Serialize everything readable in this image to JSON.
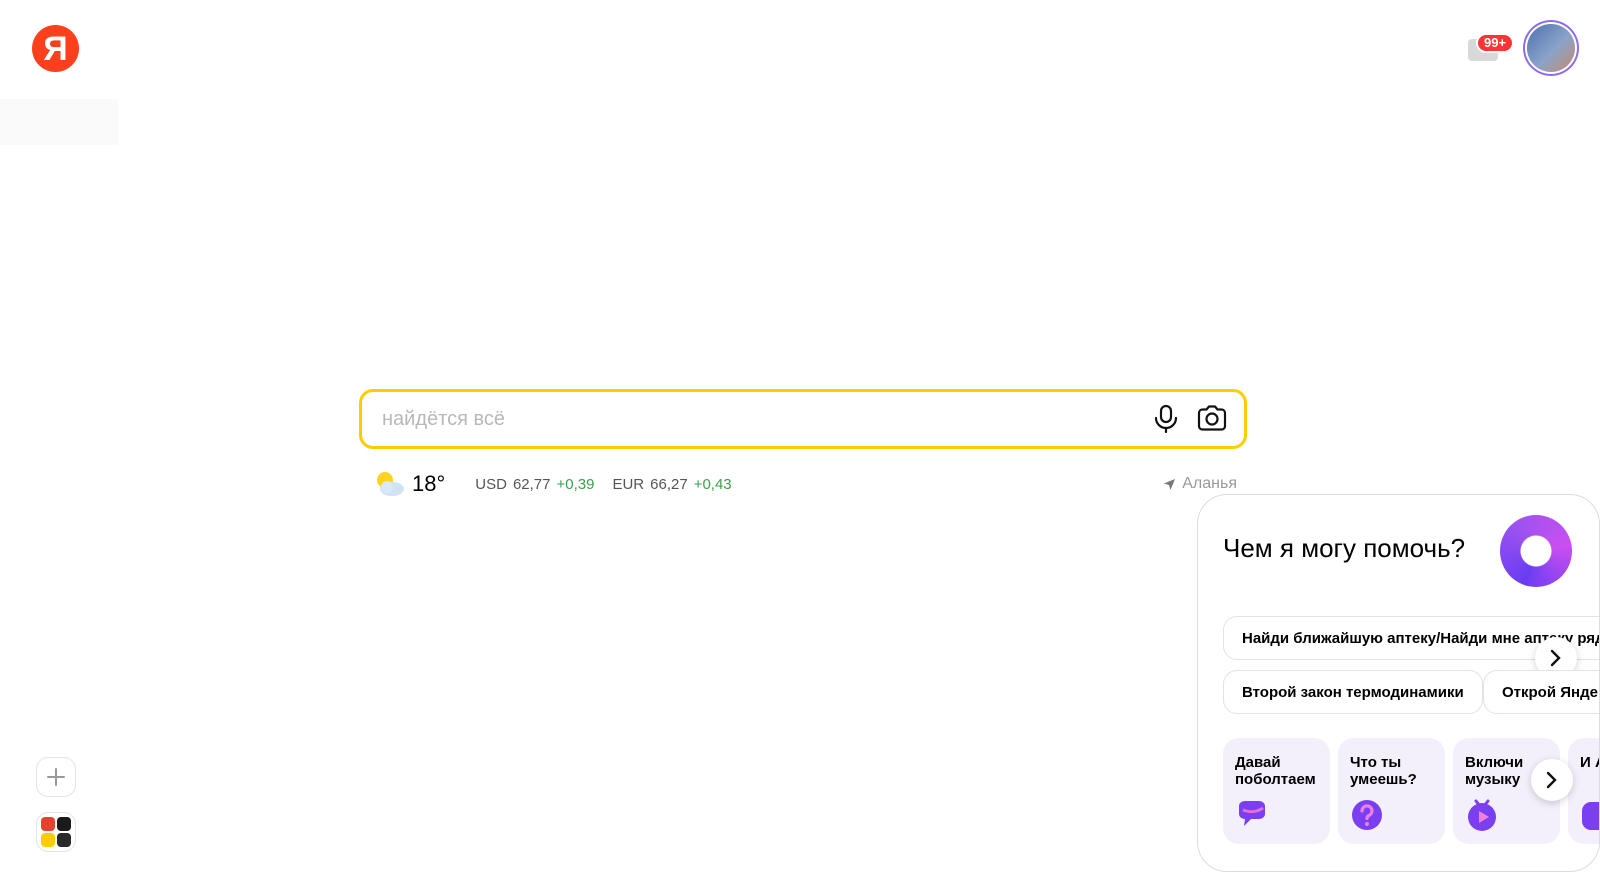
{
  "header": {
    "logo_text": "Я",
    "mail_badge": "99+",
    "colors": {
      "logo": "#fc3f1d",
      "badge": "#ff3333"
    }
  },
  "search": {
    "placeholder": "найдётся всё",
    "voice_icon": "microphone-icon",
    "camera_icon": "camera-search-icon",
    "border_color": "#ffcc00"
  },
  "info": {
    "weather_icon": "partly-cloudy-icon",
    "temperature": "18°",
    "usd_label": "USD",
    "usd_value": "62,77",
    "usd_delta": "+0,39",
    "eur_label": "EUR",
    "eur_value": "66,27",
    "eur_delta": "+0,43",
    "location": "Аланья",
    "positive_color": "#3ba14a"
  },
  "alice": {
    "title": "Чем я могу помочь?",
    "suggestions": [
      "Найди ближайшую аптеку/Найди мне аптеку ряд",
      "Второй закон термодинамики",
      "Открой Янде"
    ],
    "cards": [
      {
        "label": "Давай поболтаем",
        "icon": "chat-bubble-icon"
      },
      {
        "label": "Что ты умеешь?",
        "icon": "question-icon"
      },
      {
        "label": "Включи музыку",
        "icon": "music-play-icon"
      },
      {
        "label": "И А",
        "icon": "app-icon"
      }
    ],
    "accent": "#7b3ff2"
  },
  "sidebar": {
    "add_icon": "plus-icon",
    "apps_icon": "apps-grid-icon"
  }
}
